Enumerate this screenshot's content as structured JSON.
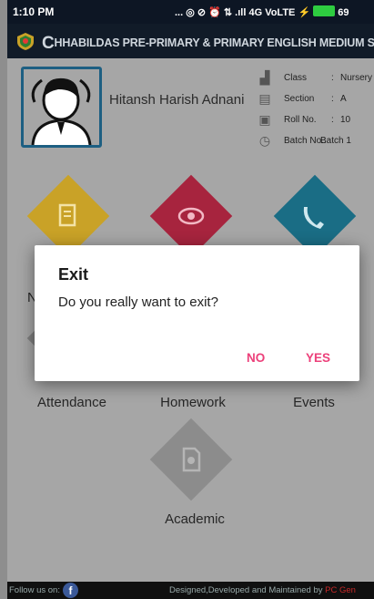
{
  "status_bar": {
    "time": "1:10 PM",
    "icons_text": "... ◎ ⊘ ⏰ ⇅ .ıll 4G VoLTE ⚡",
    "battery_text": "69"
  },
  "header": {
    "school_first_letter": "C",
    "school_rest": "HHABILDAS PRE-PRIMARY & PRIMARY ENGLISH MEDIUM SCHOOL"
  },
  "profile": {
    "student_name": "Hitansh Harish Adnani",
    "info": [
      {
        "icon": "classroom-icon",
        "label": "Class",
        "value": "Nursery"
      },
      {
        "icon": "section-board-icon",
        "label": "Section",
        "value": "A"
      },
      {
        "icon": "id-card-icon",
        "label": "Roll No.",
        "value": "10"
      },
      {
        "icon": "clock-icon",
        "label": "Batch No.:",
        "value": "Batch 1"
      }
    ]
  },
  "tiles": [
    {
      "name": "notes",
      "label": "",
      "color": "#c9a227",
      "icon": "note-edit-icon"
    },
    {
      "name": "vision",
      "label": "",
      "color": "#a7243e",
      "icon": "eye-scan-icon"
    },
    {
      "name": "contact",
      "label": "",
      "color": "#1a6d85",
      "icon": "phone-icon"
    },
    {
      "name": "attendance",
      "label": "Attendance",
      "color": "#7f7f7f",
      "icon": ""
    },
    {
      "name": "homework",
      "label": "Homework",
      "color": "#7f7f7f",
      "icon": ""
    },
    {
      "name": "events",
      "label": "Events",
      "color": "#7f7f7f",
      "icon": ""
    },
    {
      "name": "academic",
      "label": "Academic",
      "color": "#8c8c8c",
      "icon": "document-icon"
    }
  ],
  "partial_label_left": "N",
  "dialog": {
    "title": "Exit",
    "message": "Do you really want to exit?",
    "no_label": "NO",
    "yes_label": "YES",
    "accent_color": "#ec407a"
  },
  "footer": {
    "follow_text": "Follow us on:",
    "facebook_letter": "f",
    "credit_text": "Designed,Developed and Maintained by",
    "brand_text": "PC Gen"
  }
}
